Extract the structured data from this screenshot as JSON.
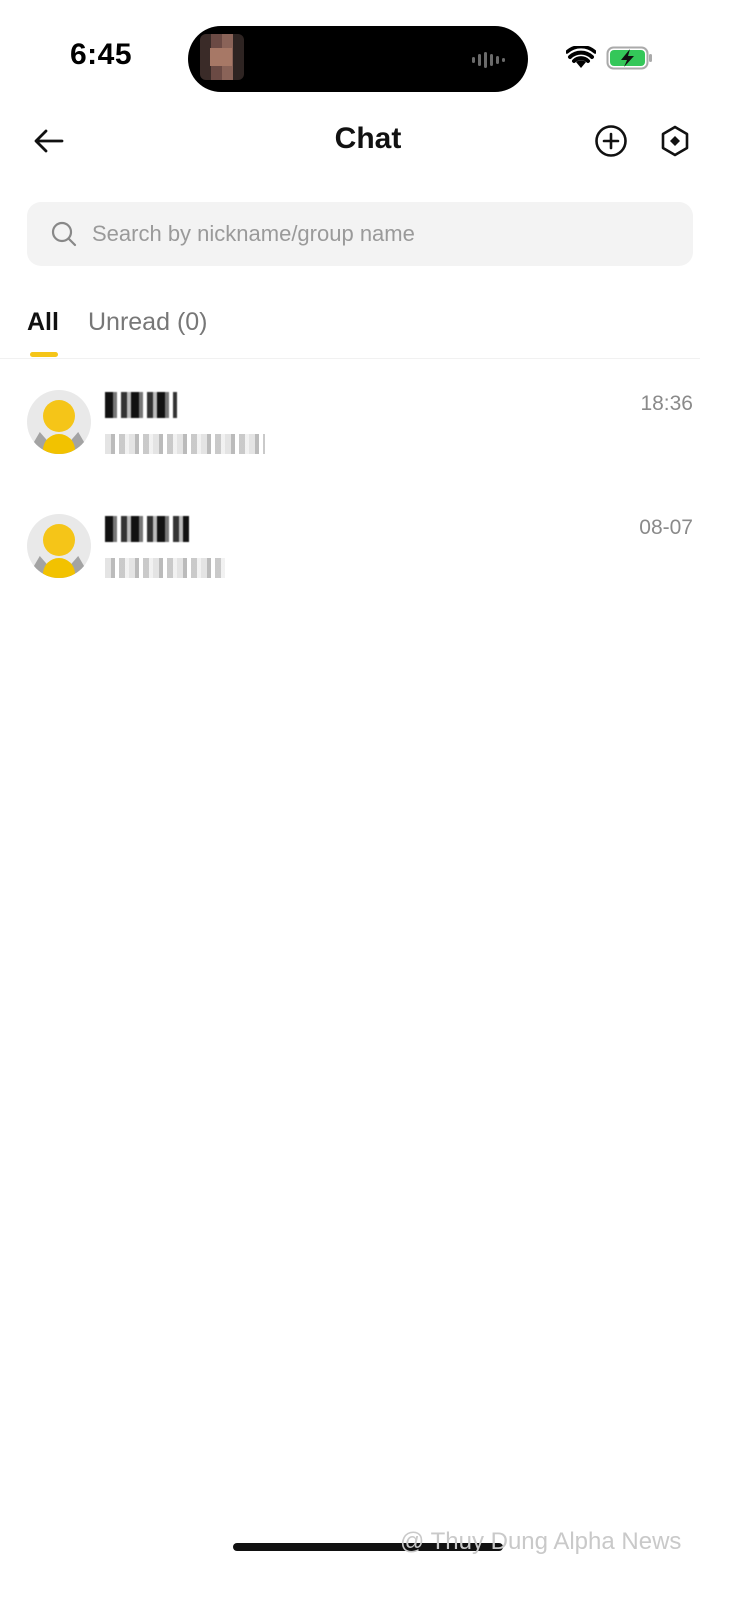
{
  "status_bar": {
    "time": "6:45",
    "icons": [
      "wifi-icon",
      "battery-charging-icon"
    ],
    "battery_color": "#34c759"
  },
  "header": {
    "title": "Chat",
    "back_icon": "arrow-left-icon",
    "add_icon": "plus-circle-icon",
    "settings_icon": "hexagon-settings-icon"
  },
  "search": {
    "placeholder": "Search by nickname/group name",
    "value": ""
  },
  "tabs": [
    {
      "label": "All",
      "active": true
    },
    {
      "label": "Unread (0)",
      "active": false
    }
  ],
  "accent_color": "#f5c518",
  "chats": [
    {
      "time": "18:36",
      "name_redacted": true,
      "preview_redacted": true
    },
    {
      "time": "08-07",
      "name_redacted": true,
      "preview_redacted": true
    }
  ],
  "watermark": "@ Thuy Dung Alpha News"
}
